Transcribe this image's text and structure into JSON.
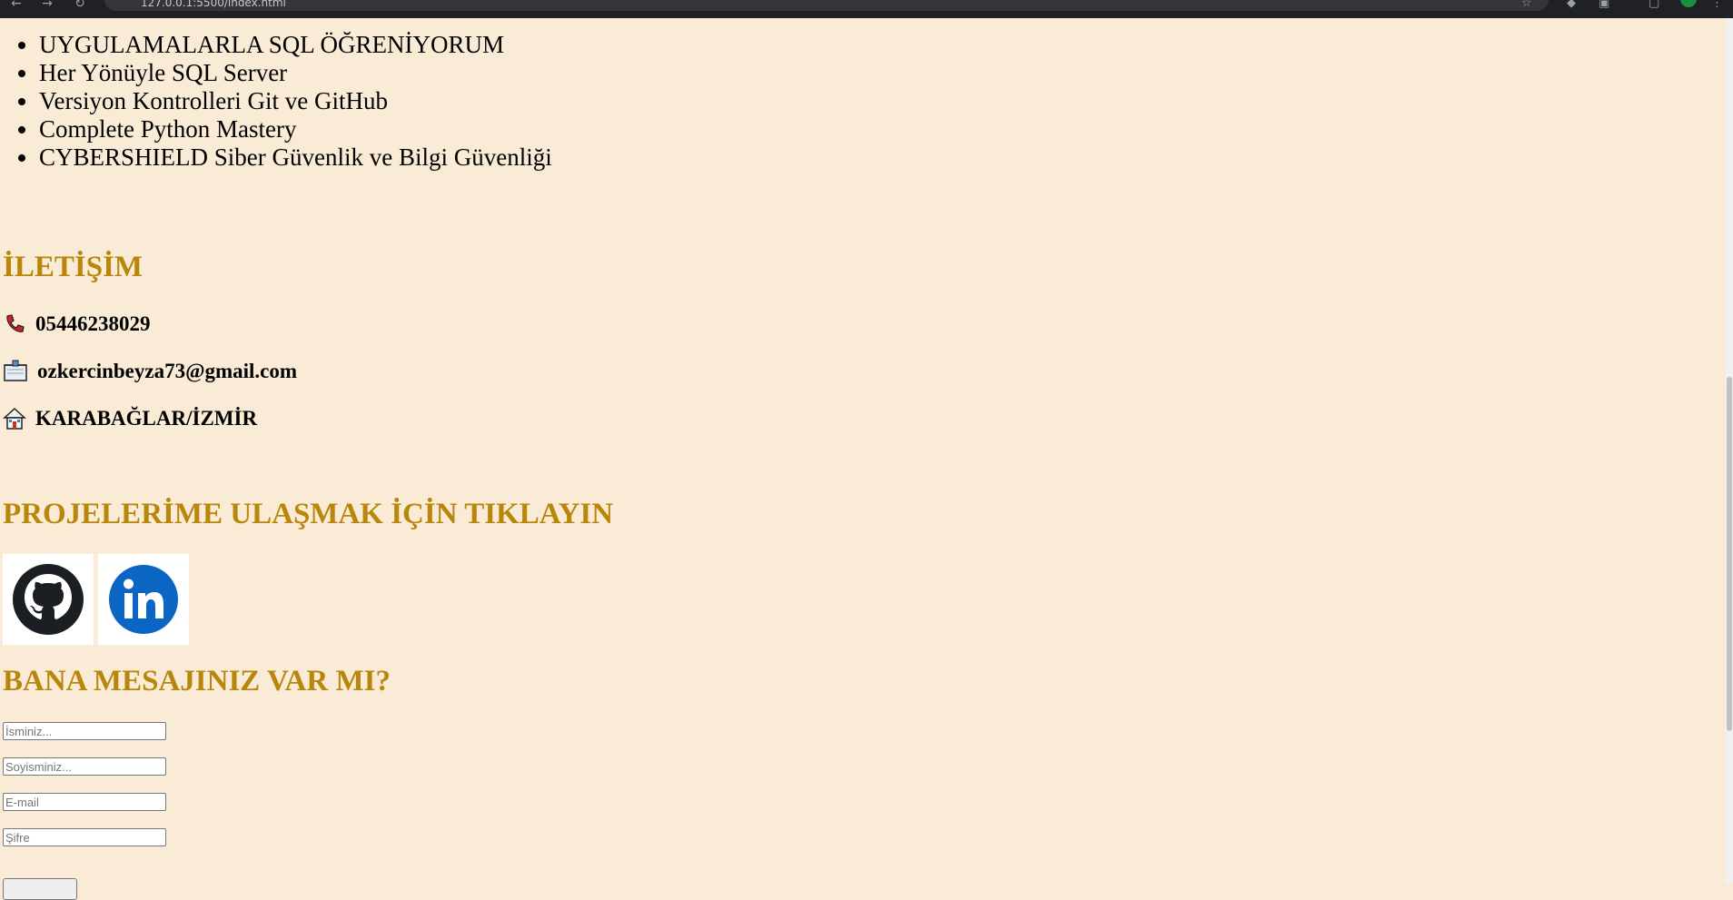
{
  "browser": {
    "url": "127.0.0.1:5500/index.html"
  },
  "courses": [
    "UYGULAMALARLA SQL ÖĞRENİYORUM",
    "Her Yönüyle SQL Server",
    "Versiyon Kontrolleri Git ve GitHub",
    "Complete Python Mastery",
    "CYBERSHIELD Siber Güvenlik ve Bilgi Güvenliği"
  ],
  "contact": {
    "heading": "İLETİŞİM",
    "phone": "05446238029",
    "email": "ozkercinbeyza73@gmail.com",
    "location": "KARABAĞLAR/İZMİR"
  },
  "projects": {
    "heading": "PROJELERİME ULAŞMAK İÇİN TIKLAYIN",
    "links": [
      {
        "icon": "github-icon"
      },
      {
        "icon": "linkedin-icon"
      }
    ]
  },
  "message_form": {
    "heading": "BANA MESAJINIZ VAR MI?",
    "name_placeholder": "İsminiz...",
    "surname_placeholder": "Soyisminiz...",
    "email_placeholder": "E-mail",
    "password_placeholder": "Şifre"
  },
  "colors": {
    "background": "#faebd7",
    "heading": "#b8860b",
    "linkedin": "#0a66c2",
    "github": "#1b1f23"
  }
}
